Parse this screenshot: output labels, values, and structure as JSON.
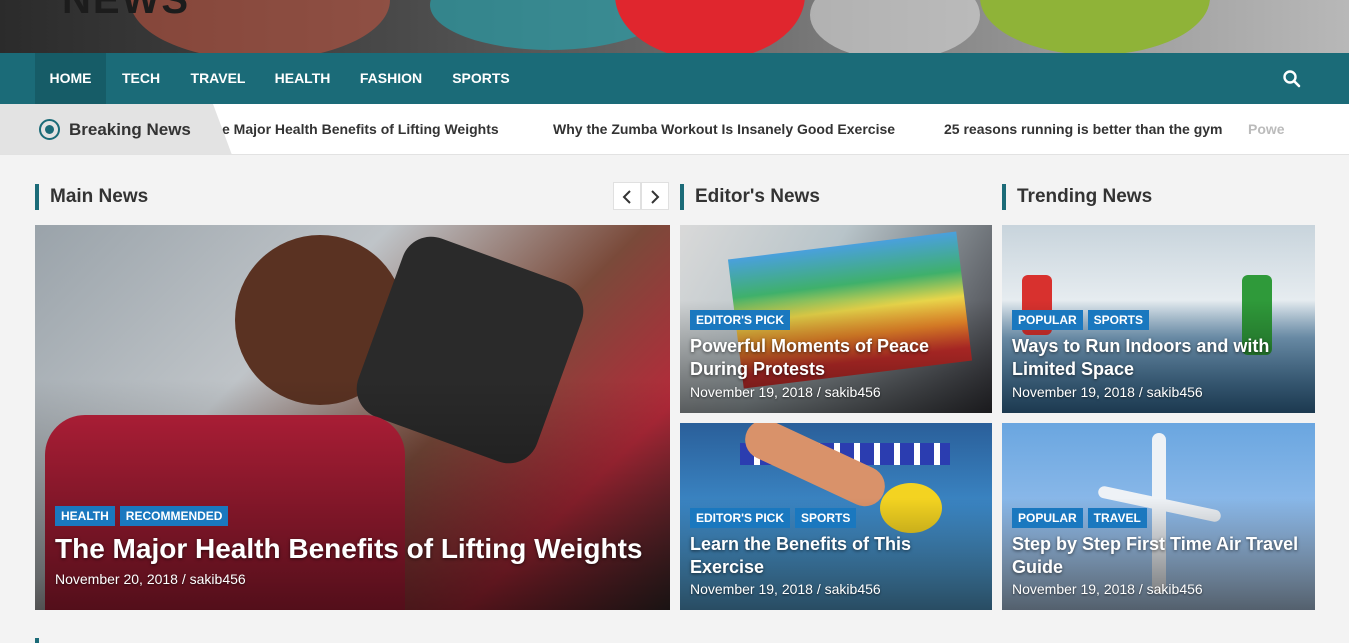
{
  "site": {
    "logo_text": "NEWS"
  },
  "nav": {
    "items": [
      {
        "label": "HOME",
        "active": true
      },
      {
        "label": "TECH"
      },
      {
        "label": "TRAVEL"
      },
      {
        "label": "HEALTH"
      },
      {
        "label": "FASHION"
      },
      {
        "label": "SPORTS"
      }
    ],
    "search_icon": "search-icon"
  },
  "breaking": {
    "label": "Breaking News",
    "items": [
      "e Major Health Benefits of Lifting Weights",
      "Why the Zumba Workout Is Insanely Good Exercise",
      "25 reasons running is better than the gym",
      "Powe"
    ]
  },
  "sections": {
    "main": {
      "title": "Main News"
    },
    "editors": {
      "title": "Editor's News"
    },
    "trending": {
      "title": "Trending News"
    }
  },
  "main_article": {
    "tags": [
      "HEALTH",
      "RECOMMENDED"
    ],
    "title": "The Major Health Benefits of Lifting Weights",
    "date": "November 20, 2018",
    "author": "sakib456"
  },
  "editors_articles": [
    {
      "tags": [
        "EDITOR'S PICK"
      ],
      "title": "Powerful Moments of Peace During Protests",
      "date": "November 19, 2018",
      "author": "sakib456"
    },
    {
      "tags": [
        "EDITOR'S PICK",
        "SPORTS"
      ],
      "title": "Learn the Benefits of This Exercise",
      "date": "November 19, 2018",
      "author": "sakib456"
    }
  ],
  "trending_articles": [
    {
      "tags": [
        "POPULAR",
        "SPORTS"
      ],
      "title": "Ways to Run Indoors and with Limited Space",
      "date": "November 19, 2018",
      "author": "sakib456"
    },
    {
      "tags": [
        "POPULAR",
        "TRAVEL"
      ],
      "title": "Step by Step First Time Air Travel Guide",
      "date": "November 19, 2018",
      "author": "sakib456"
    }
  ],
  "meta_separator": " / ",
  "colors": {
    "primary": "#1b6b78",
    "tag": "#1a78bf"
  }
}
